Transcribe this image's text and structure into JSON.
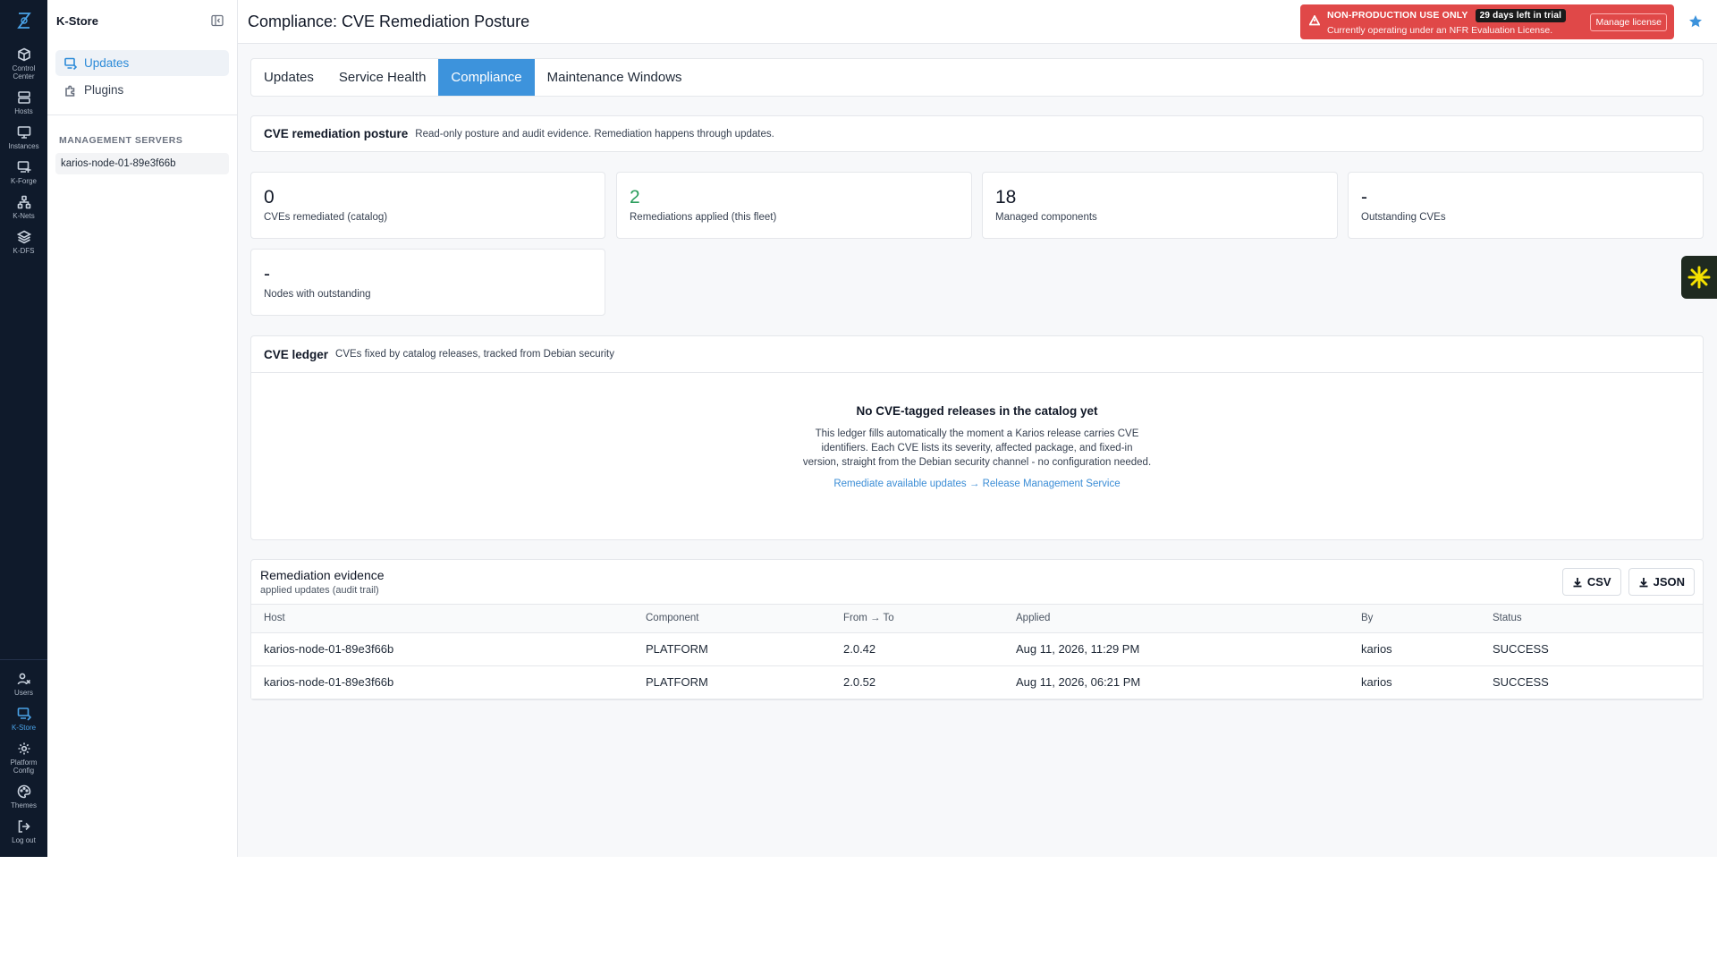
{
  "rail": {
    "items": [
      {
        "id": "control-center",
        "label": "Control\nCenter",
        "label1": "Control",
        "label2": "Center"
      },
      {
        "id": "hosts",
        "label1": "Hosts"
      },
      {
        "id": "instances",
        "label1": "Instances"
      },
      {
        "id": "k-forge",
        "label1": "K-Forge"
      },
      {
        "id": "k-nets",
        "label1": "K-Nets"
      },
      {
        "id": "k-dfs",
        "label1": "K-DFS"
      }
    ],
    "bottom_items": [
      {
        "id": "users",
        "label1": "Users"
      },
      {
        "id": "k-store",
        "label1": "K-Store"
      },
      {
        "id": "platform-config",
        "label1": "Platform",
        "label2": "Config"
      },
      {
        "id": "themes",
        "label1": "Themes"
      },
      {
        "id": "log-out",
        "label1": "Log out"
      }
    ]
  },
  "sidebar": {
    "title": "K-Store",
    "nav": [
      {
        "label": "Updates",
        "active": true
      },
      {
        "label": "Plugins",
        "active": false
      }
    ],
    "section_label": "MANAGEMENT SERVERS",
    "servers": [
      "karios-node-01-89e3f66b"
    ]
  },
  "header": {
    "title": "Compliance: CVE Remediation Posture",
    "banner": {
      "line1": "NON-PRODUCTION USE ONLY",
      "badge": "29 days left in trial",
      "line2": "Currently operating under an NFR Evaluation License.",
      "button": "Manage license",
      "color": "#e04848"
    }
  },
  "tabs": [
    {
      "label": "Updates",
      "active": false
    },
    {
      "label": "Service Health",
      "active": false
    },
    {
      "label": "Compliance",
      "active": true
    },
    {
      "label": "Maintenance Windows",
      "active": false
    }
  ],
  "posture": {
    "title": "CVE remediation posture",
    "subtitle": "Read-only posture and audit evidence. Remediation happens through updates."
  },
  "stats": [
    {
      "value": "0",
      "label": "CVEs remediated (catalog)"
    },
    {
      "value": "2",
      "label": "Remediations applied (this fleet)",
      "accent": "#2a9d5c"
    },
    {
      "value": "18",
      "label": "Managed components"
    },
    {
      "value": "-",
      "label": "Outstanding CVEs"
    },
    {
      "value": "-",
      "label": "Nodes with outstanding"
    }
  ],
  "ledger": {
    "title": "CVE ledger",
    "subtitle": "CVEs fixed by catalog releases, tracked from Debian security",
    "empty_title": "No CVE-tagged releases in the catalog yet",
    "empty_desc": "This ledger fills automatically the moment a Karios release carries CVE identifiers. Each CVE lists its severity, affected package, and fixed-in version, straight from the Debian security channel - no configuration needed.",
    "empty_link": "Remediate available updates → Release Management Service"
  },
  "evidence": {
    "title": "Remediation evidence",
    "subtitle": "applied updates (audit trail)",
    "csv_label": "CSV",
    "json_label": "JSON",
    "columns": [
      "Host",
      "Component",
      "From → To",
      "Applied",
      "By",
      "Status"
    ],
    "rows": [
      [
        "karios-node-01-89e3f66b",
        "PLATFORM",
        "2.0.42",
        "Aug 11, 2026, 11:29 PM",
        "karios",
        "SUCCESS"
      ],
      [
        "karios-node-01-89e3f66b",
        "PLATFORM",
        "2.0.52",
        "Aug 11, 2026, 06:21 PM",
        "karios",
        "SUCCESS"
      ]
    ]
  },
  "colors": {
    "accent": "#3d93dc",
    "rail_bg": "#0f1a2b",
    "success_value": "#2a9d5c",
    "banner": "#e04848"
  }
}
